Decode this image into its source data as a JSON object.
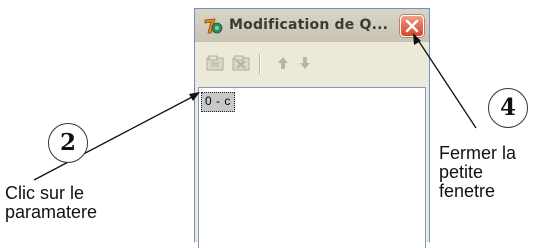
{
  "window": {
    "title": "Modification de Q...",
    "title_icon": "app-icon",
    "close_icon": "close-icon",
    "toolbar_icons": [
      "add-icon",
      "remove-icon",
      "up-arrow-icon",
      "down-arrow-icon"
    ],
    "parameter_item": "0 - c"
  },
  "annotations": {
    "callout_2": "2",
    "callout_4": "4",
    "note_left": [
      "Clic sur le",
      "paramatere"
    ],
    "note_right": [
      "Fermer la",
      "petite",
      "fenetre"
    ]
  },
  "colors": {
    "close_button": "#e1654d",
    "selection": "#c8c8c8",
    "frame": "#6f8fc5"
  }
}
